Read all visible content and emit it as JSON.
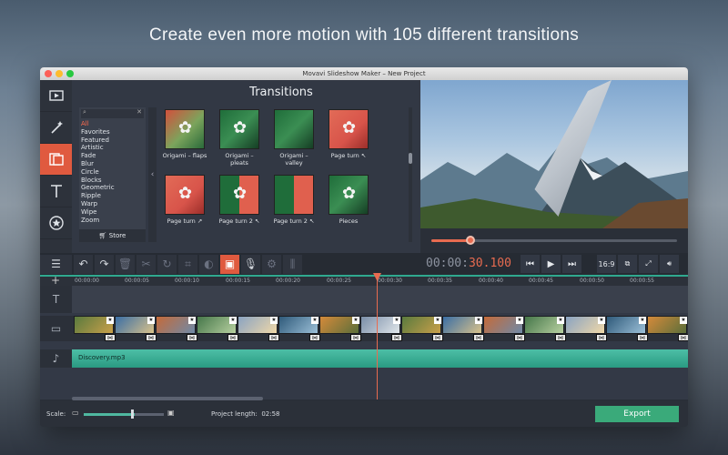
{
  "headline": "Create even more motion with 105 different transitions",
  "window": {
    "title": "Movavi Slideshow Maker – New Project"
  },
  "transitions": {
    "title": "Transitions",
    "categories": [
      "All",
      "Favorites",
      "Featured",
      "Artistic",
      "Fade",
      "Blur",
      "Circle",
      "Blocks",
      "Geometric",
      "Ripple",
      "Warp",
      "Wipe",
      "Zoom"
    ],
    "selected_category": "All",
    "store_label": "Store",
    "items": [
      {
        "label": "Origami – flaps"
      },
      {
        "label": "Origami – pleats"
      },
      {
        "label": "Origami – valley"
      },
      {
        "label": "Page turn ↖"
      },
      {
        "label": "Page turn ↗"
      },
      {
        "label": "Page turn 2 ↖"
      },
      {
        "label": "Page turn 2 ↖"
      },
      {
        "label": "Pieces"
      }
    ]
  },
  "player": {
    "progress_fraction": 0.16,
    "timecode_dim": "00:00:",
    "timecode_active": "30.100",
    "aspect_label": "16:9"
  },
  "timeline": {
    "ticks": [
      "00:00:00",
      "00:00:05",
      "00:00:10",
      "00:00:15",
      "00:00:20",
      "00:00:25",
      "00:00:30",
      "00:00:35",
      "00:00:40",
      "00:00:45",
      "00:00:50",
      "00:00:55"
    ],
    "audio_clip": "Discovery.mp3"
  },
  "footer": {
    "scale_label": "Scale:",
    "project_length_label": "Project length:",
    "project_length_value": "02:58",
    "export_label": "Export"
  }
}
